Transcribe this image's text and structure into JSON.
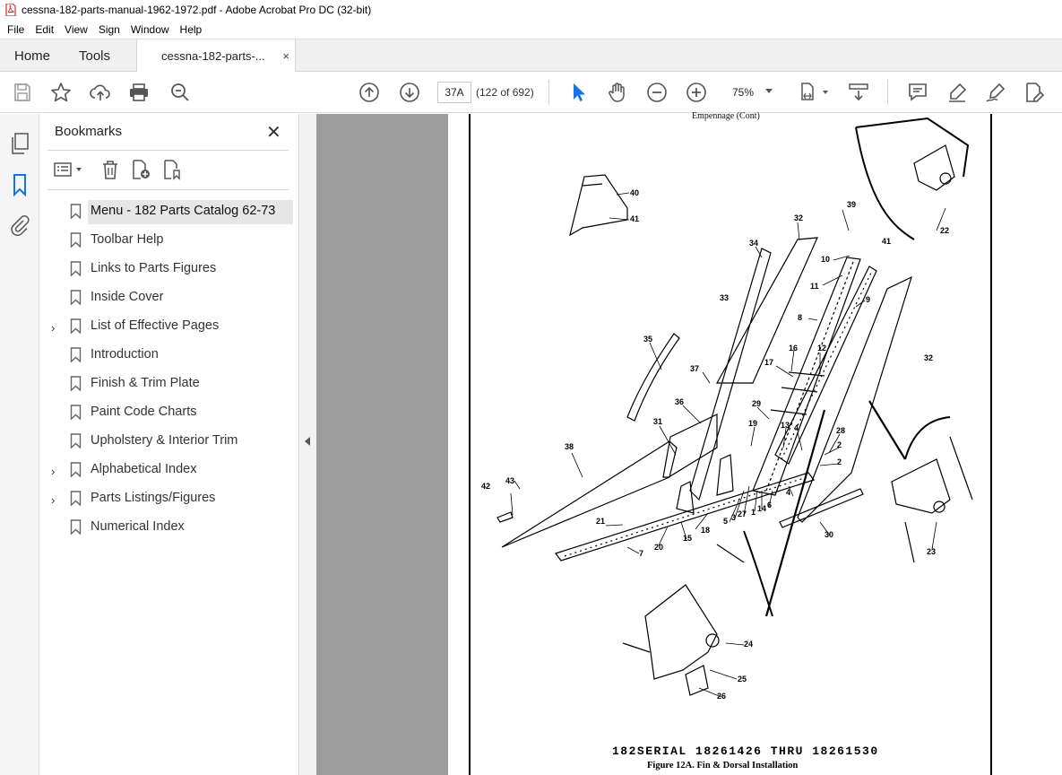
{
  "window": {
    "title": "cessna-182-parts-manual-1962-1972.pdf - Adobe Acrobat Pro DC (32-bit)"
  },
  "menu": [
    "File",
    "Edit",
    "View",
    "Sign",
    "Window",
    "Help"
  ],
  "tabs": {
    "home": "Home",
    "tools": "Tools",
    "document": "cessna-182-parts-...",
    "close": "×"
  },
  "toolbar": {
    "page_label": "37A",
    "page_count": "(122 of 692)",
    "zoom": "75%",
    "icons": [
      "save-icon",
      "star-icon",
      "upload-icon",
      "print-icon",
      "search-zoom-icon",
      "page-up-icon",
      "page-down-icon",
      "select-cursor-icon",
      "hand-icon",
      "zoom-out-icon",
      "zoom-in-icon",
      "fit-page-icon",
      "scroll-mode-icon",
      "comment-icon",
      "highlight-icon",
      "sign-icon",
      "edit-pdf-icon"
    ]
  },
  "accent_color": "#1473e6",
  "rail": [
    "pages-icon",
    "bookmark-icon",
    "attachment-icon"
  ],
  "bookmarks": {
    "title": "Bookmarks",
    "close": "✕",
    "items": [
      {
        "label": "Menu - 182 Parts Catalog 62-73",
        "expandable": false,
        "selected": true
      },
      {
        "label": "Toolbar Help",
        "expandable": false,
        "selected": false
      },
      {
        "label": "Links to Parts Figures",
        "expandable": false,
        "selected": false
      },
      {
        "label": "Inside Cover",
        "expandable": false,
        "selected": false
      },
      {
        "label": "List of Effective Pages",
        "expandable": true,
        "selected": false
      },
      {
        "label": "Introduction",
        "expandable": false,
        "selected": false
      },
      {
        "label": "Finish & Trim Plate",
        "expandable": false,
        "selected": false
      },
      {
        "label": "Paint Code Charts",
        "expandable": false,
        "selected": false
      },
      {
        "label": "Upholstery & Interior Trim",
        "expandable": false,
        "selected": false
      },
      {
        "label": "Alphabetical Index",
        "expandable": true,
        "selected": false
      },
      {
        "label": "Parts Listings/Figures",
        "expandable": true,
        "selected": false
      },
      {
        "label": "Numerical Index",
        "expandable": false,
        "selected": false
      }
    ]
  },
  "pdf": {
    "header": "Empennage (Cont)",
    "serial": "182SERIAL 18261426 THRU 18261530",
    "caption": "Figure 12A.  Fin & Dorsal Installation",
    "callouts": [
      "40",
      "41",
      "39",
      "32",
      "34",
      "10",
      "11",
      "9",
      "33",
      "8",
      "22",
      "35",
      "37",
      "16",
      "12",
      "17",
      "36",
      "29",
      "31",
      "19",
      "13",
      "4",
      "28",
      "38",
      "2",
      "43",
      "42",
      "5",
      "3",
      "27",
      "1",
      "14",
      "6",
      "21",
      "20",
      "18",
      "15",
      "7",
      "30",
      "23",
      "24",
      "25",
      "26"
    ]
  }
}
